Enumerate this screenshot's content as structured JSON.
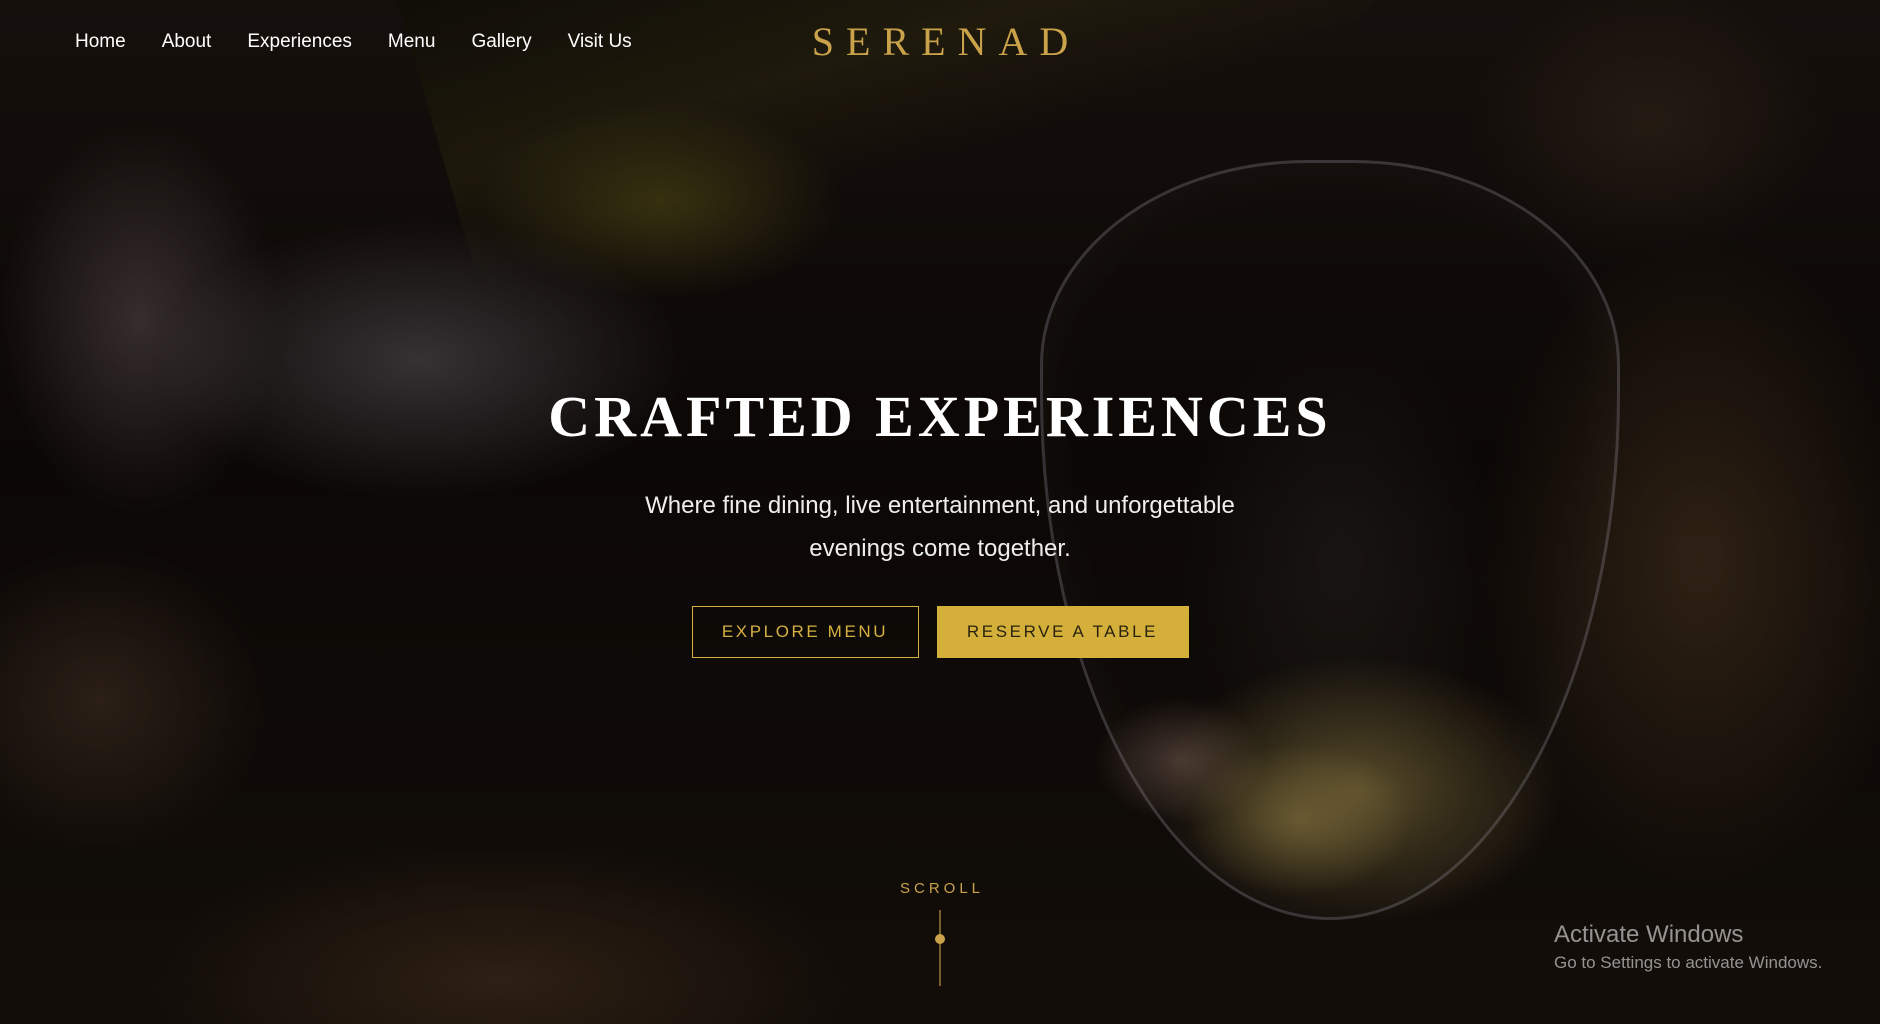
{
  "nav": {
    "items": [
      {
        "label": "Home"
      },
      {
        "label": "About"
      },
      {
        "label": "Experiences"
      },
      {
        "label": "Menu"
      },
      {
        "label": "Gallery"
      },
      {
        "label": "Visit Us"
      }
    ]
  },
  "brand": {
    "name": "SERENAD"
  },
  "hero": {
    "headline": "CRAFTED EXPERIENCES",
    "subheadline": "Where fine dining, live entertainment, and unforgettable evenings come together.",
    "cta_primary": "EXPLORE MENU",
    "cta_secondary": "RESERVE A TABLE"
  },
  "scroll": {
    "label": "SCROLL"
  },
  "watermark": {
    "title": "Activate Windows",
    "subtitle": "Go to Settings to activate Windows."
  },
  "colors": {
    "accent_gold": "#c9a24a",
    "button_gold": "#d4b03a",
    "text_white": "#ffffff"
  },
  "icons": {
    "scroll_indicator": "scroll-line-dot"
  }
}
